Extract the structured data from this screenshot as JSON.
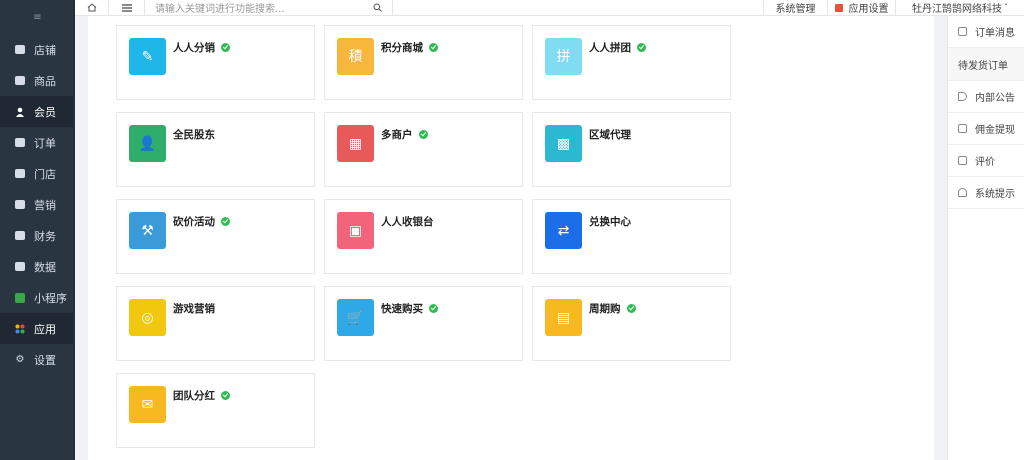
{
  "sidebar": {
    "toggle": "≡",
    "items": [
      {
        "label": "店铺",
        "icon": "store-icon"
      },
      {
        "label": "商品",
        "icon": "goods-icon"
      },
      {
        "label": "会员",
        "icon": "member-icon"
      },
      {
        "label": "订单",
        "icon": "order-icon"
      },
      {
        "label": "门店",
        "icon": "shop-icon"
      },
      {
        "label": "营销",
        "icon": "marketing-icon"
      },
      {
        "label": "财务",
        "icon": "finance-icon"
      },
      {
        "label": "数据",
        "icon": "data-icon"
      },
      {
        "label": "小程序",
        "icon": "miniprogram-icon"
      },
      {
        "label": "应用",
        "icon": "apps-icon"
      },
      {
        "label": "设置",
        "icon": "settings-icon"
      }
    ]
  },
  "topbar": {
    "search_placeholder": "请输入关键词进行功能搜索...",
    "system_manage": "系统管理",
    "app_settings": "应用设置",
    "user": "牡丹江鹄鹄网络科技"
  },
  "apps": [
    {
      "name": "人人分销",
      "color": "#1fb6e8",
      "installed": true
    },
    {
      "name": "积分商城",
      "color": "#f6b73c",
      "installed": true
    },
    {
      "name": "人人拼团",
      "color": "#7fdcf2",
      "installed": true
    },
    {
      "name": "全民股东",
      "color": "#2fae6b",
      "installed": false
    },
    {
      "name": "多商户",
      "color": "#e85a5a",
      "installed": true
    },
    {
      "name": "区域代理",
      "color": "#2bb8d0",
      "installed": false
    },
    {
      "name": "砍价活动",
      "color": "#3a9bd8",
      "installed": true
    },
    {
      "name": "人人收银台",
      "color": "#f2647a",
      "installed": false
    },
    {
      "name": "兑换中心",
      "color": "#1c6ee8",
      "installed": false
    },
    {
      "name": "游戏营销",
      "color": "#f2c80f",
      "installed": false
    },
    {
      "name": "快速购买",
      "color": "#2ea8e6",
      "installed": true
    },
    {
      "name": "周期购",
      "color": "#f8b820",
      "installed": true
    },
    {
      "name": "团队分红",
      "color": "#f8b820",
      "installed": true
    }
  ],
  "right_panel": {
    "order_msg": "订单消息",
    "pending": "待发货订单",
    "notice": "内部公告",
    "commission": "佣金提现",
    "review": "评价",
    "system_tip": "系统提示"
  }
}
